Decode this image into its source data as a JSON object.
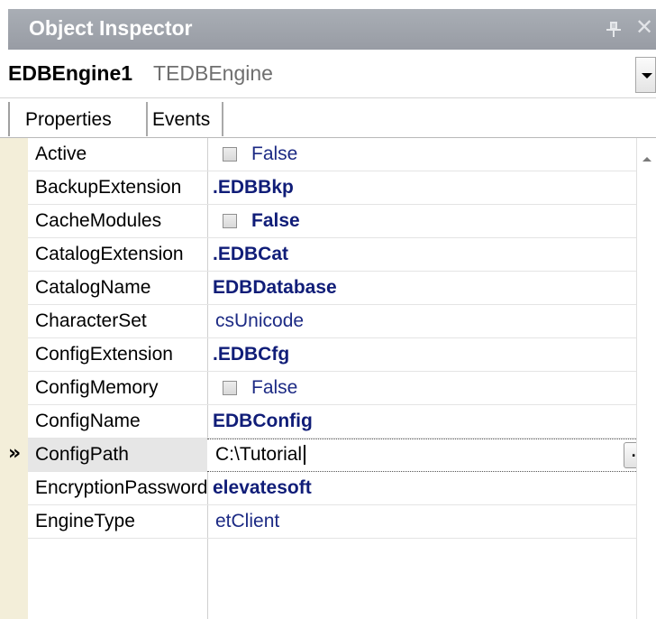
{
  "window": {
    "title": "Object Inspector"
  },
  "selector": {
    "component_name": "EDBEngine1",
    "component_type": "TEDBEngine"
  },
  "tabs": [
    {
      "label": "Properties"
    },
    {
      "label": "Events"
    }
  ],
  "grid": {
    "selected_marker": "»",
    "rows": [
      {
        "name": "Active",
        "value": "False",
        "checkbox": true,
        "bold": false
      },
      {
        "name": "BackupExtension",
        "value": ".EDBBkp",
        "checkbox": false,
        "bold": true
      },
      {
        "name": "CacheModules",
        "value": "False",
        "checkbox": true,
        "bold": true
      },
      {
        "name": "CatalogExtension",
        "value": ".EDBCat",
        "checkbox": false,
        "bold": true
      },
      {
        "name": "CatalogName",
        "value": "EDBDatabase",
        "checkbox": false,
        "bold": true
      },
      {
        "name": "CharacterSet",
        "value": "csUnicode",
        "checkbox": false,
        "bold": false
      },
      {
        "name": "ConfigExtension",
        "value": ".EDBCfg",
        "checkbox": false,
        "bold": true
      },
      {
        "name": "ConfigMemory",
        "value": "False",
        "checkbox": true,
        "bold": false
      },
      {
        "name": "ConfigName",
        "value": "EDBConfig",
        "checkbox": false,
        "bold": true
      },
      {
        "name": "ConfigPath",
        "value": "C:\\Tutorial",
        "checkbox": false,
        "bold": false,
        "selected": true,
        "button_label": "..."
      },
      {
        "name": "EncryptionPassword",
        "value": "elevatesoft",
        "checkbox": false,
        "bold": true
      },
      {
        "name": "EngineType",
        "value": "etClient",
        "checkbox": false,
        "bold": false
      }
    ]
  },
  "colors": {
    "title_bar": "#a3a8af",
    "gutter": "#f3eed9",
    "value_text": "#1c2a84",
    "selected_name_bg": "#e6e6e6"
  },
  "icons": {
    "pin": "pin-icon",
    "close": "close-icon",
    "dropdown": "chevron-down-icon",
    "scroll_up": "scroll-up-arrow-icon"
  }
}
